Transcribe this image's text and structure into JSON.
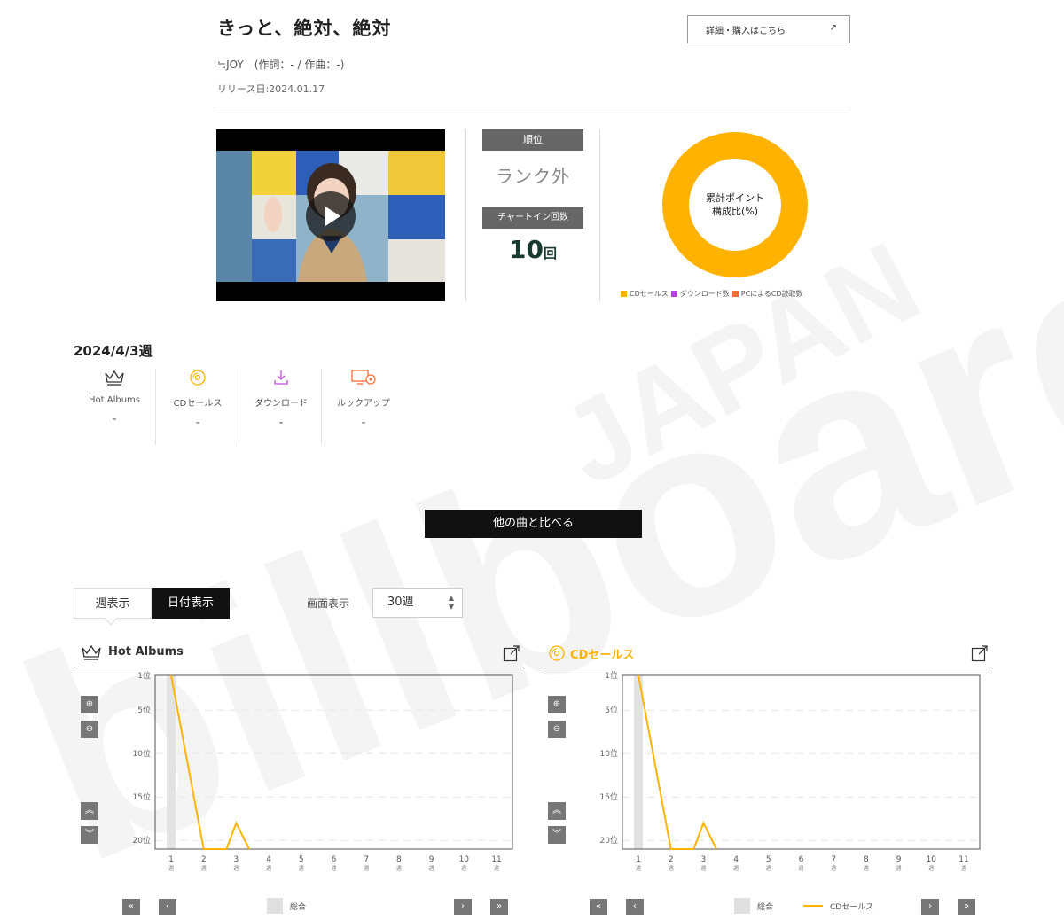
{
  "song": {
    "title": "きっと、絶対、絶対",
    "artist_line": "≒JOY　(作詞：- / 作曲：-)",
    "release": "リリース日:2024.01.17",
    "detail_button": "詳細・購入はこちら",
    "detail_arrow": "↗"
  },
  "rank": {
    "label": "順位",
    "value": "ランク外",
    "chartin_label": "チャートイン回数",
    "chartin_count": "10",
    "chartin_unit": "回"
  },
  "donut": {
    "center_line1": "累計ポイント",
    "center_line2": "構成比(%)",
    "legend": [
      {
        "label": "CDセールス",
        "color": "#ffb300"
      },
      {
        "label": "ダウンロード数",
        "color": "#b63fd9"
      },
      {
        "label": "PCによるCD読取数",
        "color": "#ff6a33"
      }
    ]
  },
  "weekly": {
    "title": "2024/4/3週",
    "stats": [
      {
        "label": "Hot Albums",
        "value": "-",
        "icon": "crown-icon",
        "color": "#333333"
      },
      {
        "label": "CDセールス",
        "value": "-",
        "icon": "cd-icon",
        "color": "#ffb300"
      },
      {
        "label": "ダウンロード",
        "value": "-",
        "icon": "download-icon",
        "color": "#c04fd6"
      },
      {
        "label": "ルックアップ",
        "value": "-",
        "icon": "lookup-icon",
        "color": "#ff6a33"
      }
    ]
  },
  "compare_button": "他の曲と比べる",
  "tabs": {
    "week": "週表示",
    "date": "日付表示"
  },
  "screen": {
    "label": "画面表示",
    "value": "30週"
  },
  "colors": {
    "accent": "#ffb300",
    "dark": "#111111"
  },
  "charts": [
    {
      "title": "Hot Albums",
      "title_color": "#333333",
      "legend": {
        "total": "総合"
      }
    },
    {
      "title": "CDセールス",
      "title_color": "#ffb300",
      "legend": {
        "total": "総合",
        "series": "CDセールス"
      }
    }
  ],
  "chart_data": [
    {
      "type": "line",
      "title": "Hot Albums",
      "y_ticks": [
        "1位",
        "5位",
        "10位",
        "15位",
        "20位"
      ],
      "x_ticks": [
        "1週",
        "2週",
        "3週",
        "4週",
        "5週",
        "6週",
        "7週",
        "8週",
        "9週",
        "10週",
        "11週"
      ],
      "ylim": [
        1,
        21
      ],
      "y_inverted": true,
      "series": [
        {
          "name": "",
          "color": "#ffb300",
          "x": [
            1,
            2,
            2.7,
            3,
            3.4
          ],
          "y": [
            1,
            21,
            21,
            18,
            21
          ]
        }
      ],
      "highlight_week": 1,
      "grid": true
    },
    {
      "type": "line",
      "title": "CDセールス",
      "y_ticks": [
        "1位",
        "5位",
        "10位",
        "15位",
        "20位"
      ],
      "x_ticks": [
        "1週",
        "2週",
        "3週",
        "4週",
        "5週",
        "6週",
        "7週",
        "8週",
        "9週",
        "10週",
        "11週"
      ],
      "ylim": [
        1,
        21
      ],
      "y_inverted": true,
      "series": [
        {
          "name": "CDセールス",
          "color": "#ffb300",
          "x": [
            1,
            2,
            2.7,
            3,
            3.4
          ],
          "y": [
            1,
            21,
            21,
            18,
            21
          ]
        }
      ],
      "highlight_week": 1,
      "grid": true
    }
  ]
}
